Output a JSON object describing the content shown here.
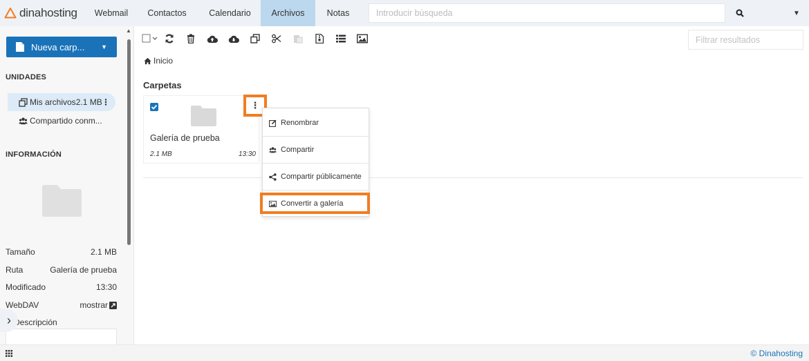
{
  "app": {
    "brand": "dinahosting",
    "accent": "#1a73b9",
    "highlight": "#f07d22"
  },
  "nav": {
    "tabs": [
      {
        "label": "Webmail"
      },
      {
        "label": "Contactos"
      },
      {
        "label": "Calendario"
      },
      {
        "label": "Archivos",
        "active": true
      },
      {
        "label": "Notas"
      }
    ],
    "search_placeholder": "Introducir búsqueda"
  },
  "sidebar": {
    "new_button": "Nueva carp...",
    "units_title": "UNIDADES",
    "units": [
      {
        "label": "Mis archivos",
        "size": "2.1 MB",
        "icon": "copy-icon",
        "active": true
      },
      {
        "label": "Compartido conm...",
        "icon": "users-icon"
      }
    ],
    "info_title": "INFORMACIÓN",
    "info": [
      {
        "key": "Tamaño",
        "value": "2.1 MB"
      },
      {
        "key": "Ruta",
        "value": "Galería de prueba"
      },
      {
        "key": "Modificado",
        "value": "13:30"
      },
      {
        "key": "WebDAV",
        "value": "mostrar"
      }
    ],
    "description_label": "Descripción"
  },
  "main": {
    "filter_placeholder": "Filtrar resultados",
    "breadcrumb": "Inicio",
    "folders_title": "Carpetas",
    "folder": {
      "name": "Galería de prueba",
      "size": "2.1 MB",
      "time": "13:30",
      "checked": true
    },
    "context_menu": [
      {
        "label": "Renombrar",
        "icon": "edit-icon"
      },
      {
        "label": "Compartir",
        "icon": "users-icon"
      },
      {
        "label": "Compartir públicamente",
        "icon": "share-icon"
      },
      {
        "label": "Convertir a galería",
        "icon": "image-icon",
        "highlighted": true
      }
    ]
  },
  "footer": {
    "brand": "© Dinahosting"
  }
}
